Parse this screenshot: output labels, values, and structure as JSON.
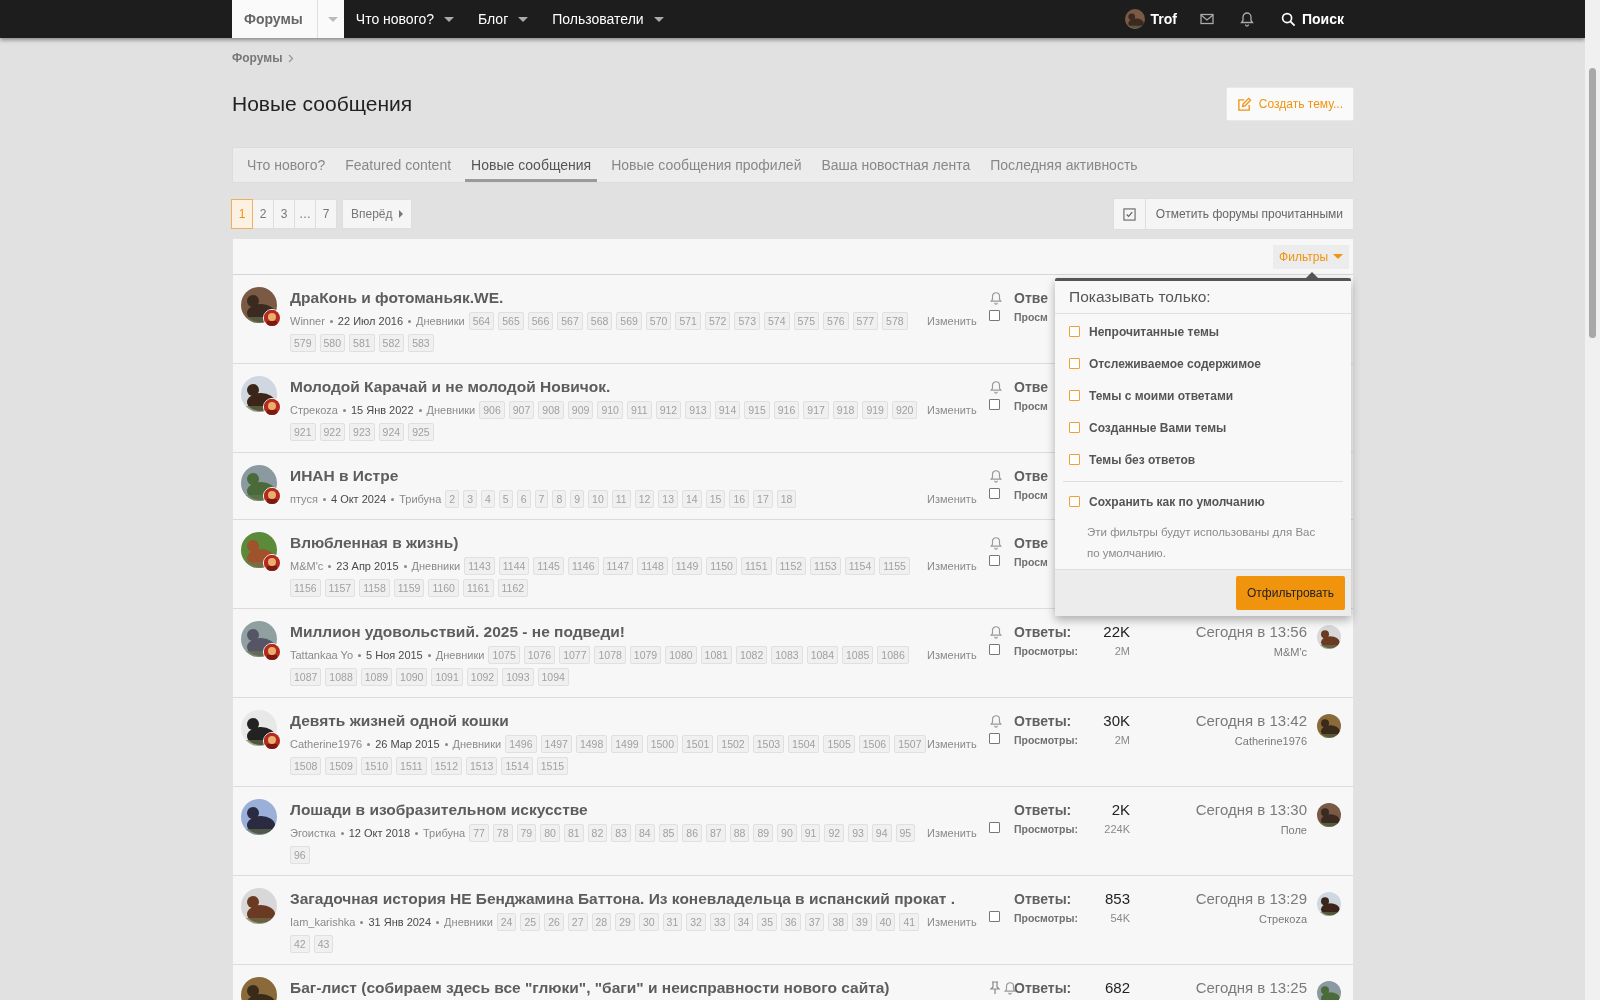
{
  "nav": {
    "items": [
      {
        "label": "Форумы",
        "selected": true
      },
      {
        "label": "Что нового?",
        "selected": false
      },
      {
        "label": "Блог",
        "selected": false
      },
      {
        "label": "Пользователи",
        "selected": false
      }
    ],
    "user": {
      "name": "Trof"
    },
    "search_label": "Поиск"
  },
  "breadcrumb": [
    "Форумы"
  ],
  "page_title": "Новые сообщения",
  "create_button": "Создать тему...",
  "tabs": [
    {
      "label": "Что нового?",
      "selected": false
    },
    {
      "label": "Featured content",
      "selected": false
    },
    {
      "label": "Новые сообщения",
      "selected": true
    },
    {
      "label": "Новые сообщения профилей",
      "selected": false
    },
    {
      "label": "Ваша новостная лента",
      "selected": false
    },
    {
      "label": "Последняя активность",
      "selected": false
    }
  ],
  "pagination": {
    "pages": [
      {
        "label": "1",
        "selected": true
      },
      {
        "label": "2",
        "selected": false
      },
      {
        "label": "3",
        "selected": false
      },
      {
        "label": "…",
        "selected": false
      },
      {
        "label": "7",
        "selected": false
      }
    ],
    "next": "Вперёд"
  },
  "mark_read_button": "Отметить форумы прочитанными",
  "filters_button": "Фильтры",
  "filter_menu": {
    "title": "Показывать только:",
    "options": [
      {
        "label": "Непрочитанные темы",
        "checked": false
      },
      {
        "label": "Отслеживаемое содержимое",
        "checked": false
      },
      {
        "label": "Темы с моими ответами",
        "checked": false
      },
      {
        "label": "Созданные Вами темы",
        "checked": false
      },
      {
        "label": "Темы без ответов",
        "checked": false
      }
    ],
    "save_default": {
      "label": "Сохранить как по умолчанию",
      "checked": false
    },
    "hint": "Эти фильтры будут использованы для Вас по умолчанию.",
    "submit": "Отфильтровать"
  },
  "threads": [
    {
      "title": "ДраКонь и фотоманьяк.WE.",
      "author": "Winner",
      "date": "22 Июл 2016",
      "forum": "Дневники",
      "pages": [
        "564",
        "565",
        "566",
        "567",
        "568",
        "569",
        "570",
        "571",
        "572",
        "573",
        "574",
        "575",
        "576",
        "577",
        "578",
        "579",
        "580",
        "581",
        "582",
        "583"
      ],
      "edit": "Изменить",
      "selected": false,
      "watched": true,
      "pinned": false,
      "posted": true,
      "replies_label": "Отве",
      "views_label": "Просм"
    },
    {
      "title": "Молодой Карачай и не молодой Новичок.",
      "author": "Стрекоza",
      "date": "15 Янв 2022",
      "forum": "Дневники",
      "pages": [
        "906",
        "907",
        "908",
        "909",
        "910",
        "911",
        "912",
        "913",
        "914",
        "915",
        "916",
        "917",
        "918",
        "919",
        "920",
        "921",
        "922",
        "923",
        "924",
        "925"
      ],
      "edit": "Изменить",
      "selected": false,
      "watched": true,
      "pinned": false,
      "posted": true,
      "replies_label": "Отве",
      "views_label": "Просм"
    },
    {
      "title": "ИНАН в Истре",
      "author": "птуся",
      "date": "4 Окт 2024",
      "forum": "Трибуна",
      "pages": [
        "2",
        "3",
        "4",
        "5",
        "6",
        "7",
        "8",
        "9",
        "10",
        "11",
        "12",
        "13",
        "14",
        "15",
        "16",
        "17",
        "18"
      ],
      "edit": "Изменить",
      "selected": false,
      "watched": true,
      "pinned": false,
      "posted": true,
      "replies_label": "Отве",
      "views_label": "Просм"
    },
    {
      "title": "Влюбленная в жизнь)",
      "author": "M&M'c",
      "date": "23 Апр 2015",
      "forum": "Дневники",
      "pages": [
        "1143",
        "1144",
        "1145",
        "1146",
        "1147",
        "1148",
        "1149",
        "1150",
        "1151",
        "1152",
        "1153",
        "1154",
        "1155",
        "1156",
        "1157",
        "1158",
        "1159",
        "1160",
        "1161",
        "1162"
      ],
      "edit": "Изменить",
      "selected": false,
      "watched": true,
      "pinned": false,
      "posted": true,
      "replies_label": "Отве",
      "views_label": "Просм"
    },
    {
      "title": "Миллион удовольствий. 2025 - не подведи!",
      "author": "Tattankaa Yo",
      "date": "5 Ноя 2015",
      "forum": "Дневники",
      "pages": [
        "1075",
        "1076",
        "1077",
        "1078",
        "1079",
        "1080",
        "1081",
        "1082",
        "1083",
        "1084",
        "1085",
        "1086",
        "1087",
        "1088",
        "1089",
        "1090",
        "1091",
        "1092",
        "1093",
        "1094"
      ],
      "edit": "Изменить",
      "selected": false,
      "watched": true,
      "pinned": false,
      "posted": true,
      "replies_label": "Ответы:",
      "replies": "22K",
      "views_label": "Просмотры:",
      "views": "2M",
      "last_time": "Сегодня в 13:56",
      "last_user": "M&M'c"
    },
    {
      "title": "Девять жизней одной кошки",
      "author": "Catherine1976",
      "date": "26 Мар 2015",
      "forum": "Дневники",
      "pages": [
        "1496",
        "1497",
        "1498",
        "1499",
        "1500",
        "1501",
        "1502",
        "1503",
        "1504",
        "1505",
        "1506",
        "1507",
        "1508",
        "1509",
        "1510",
        "1511",
        "1512",
        "1513",
        "1514",
        "1515"
      ],
      "edit": "Изменить",
      "selected": false,
      "watched": true,
      "pinned": false,
      "posted": true,
      "replies_label": "Ответы:",
      "replies": "30K",
      "views_label": "Просмотры:",
      "views": "2M",
      "last_time": "Сегодня в 13:42",
      "last_user": "Catherine1976"
    },
    {
      "title": "Лошади в изобразительном искусстве",
      "author": "Эгоистка",
      "date": "12 Окт 2018",
      "forum": "Трибуна",
      "pages": [
        "77",
        "78",
        "79",
        "80",
        "81",
        "82",
        "83",
        "84",
        "85",
        "86",
        "87",
        "88",
        "89",
        "90",
        "91",
        "92",
        "93",
        "94",
        "95",
        "96"
      ],
      "edit": "Изменить",
      "selected": false,
      "watched": false,
      "pinned": false,
      "posted": false,
      "replies_label": "Ответы:",
      "replies": "2K",
      "views_label": "Просмотры:",
      "views": "224K",
      "last_time": "Сегодня в 13:30",
      "last_user": "Поле"
    },
    {
      "title": "Загадочная история НЕ Бенджамина Баттона. Из коневладельца в испанский прокат .",
      "author": "Iam_karishka",
      "date": "31 Янв 2024",
      "forum": "Дневники",
      "pages": [
        "24",
        "25",
        "26",
        "27",
        "28",
        "29",
        "30",
        "31",
        "32",
        "33",
        "34",
        "35",
        "36",
        "37",
        "38",
        "39",
        "40",
        "41",
        "42",
        "43"
      ],
      "edit": "Изменить",
      "selected": false,
      "watched": false,
      "pinned": false,
      "posted": false,
      "replies_label": "Ответы:",
      "replies": "853",
      "views_label": "Просмотры:",
      "views": "54K",
      "last_time": "Сегодня в 13:29",
      "last_user": "Стрекоza"
    },
    {
      "title": "Баг-лист (собираем здесь все \"глюки\", \"баги\" и неисправности нового сайта)",
      "watched": true,
      "pinned": true,
      "posted": false,
      "replies_label": "Ответы:",
      "replies": "682",
      "last_time": "Сегодня в 13:25"
    }
  ]
}
